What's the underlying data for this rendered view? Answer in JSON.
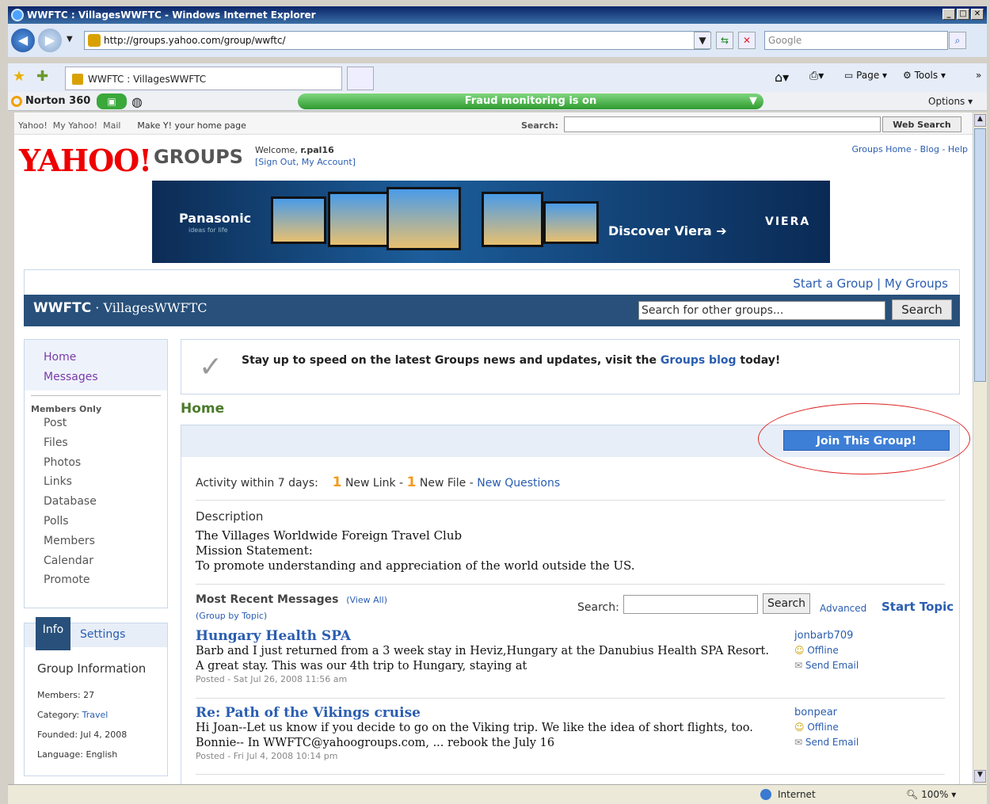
{
  "window": {
    "title": "WWFTC : VillagesWWFTC - Windows Internet Explorer"
  },
  "browser": {
    "address": "http://groups.yahoo.com/group/wwftc/",
    "search_placeholder": "Google",
    "tab_title": "WWFTC : VillagesWWFTC",
    "tools": {
      "page": "Page",
      "tools": "Tools"
    },
    "norton_label": "Norton 360",
    "fraud_status": "Fraud monitoring is on",
    "options": "Options",
    "status_zone": "Internet",
    "zoom": "100%"
  },
  "yahoo_bar": {
    "links": [
      "Yahoo!",
      "My Yahoo!",
      "Mail"
    ],
    "home_page": "Make Y! your home page",
    "search_label": "Search:",
    "search_button": "Web Search"
  },
  "header": {
    "logo": "YAHOO!",
    "logo_suffix": "GROUPS",
    "welcome_prefix": "Welcome, ",
    "username": "r.pal16",
    "sign_out": "[Sign Out, My Account]",
    "top_links": "Groups Home - Blog - Help"
  },
  "banner": {
    "brand": "Panasonic",
    "tagline": "ideas for life",
    "cta": "Discover Viera",
    "product": "VIERA"
  },
  "group_bar": {
    "links": "Start a Group | My Groups",
    "name": "WWFTC",
    "subname": " · VillagesWWFTC",
    "search_placeholder": "Search for other groups...",
    "search_button": "Search"
  },
  "leftnav": {
    "primary": [
      "Home",
      "Messages"
    ],
    "members_only_label": "Members Only",
    "items": [
      "Post",
      "Files",
      "Photos",
      "Links",
      "Database",
      "Polls",
      "Members",
      "Calendar",
      "Promote"
    ]
  },
  "info": {
    "tab_info": "Info",
    "tab_settings": "Settings",
    "heading": "Group Information",
    "members": "Members: 27",
    "category_label": "Category: ",
    "category_value": "Travel",
    "founded": "Founded: Jul 4, 2008",
    "language": "Language: English"
  },
  "news": {
    "text_before": "Stay up to speed on the latest Groups news and updates, visit the ",
    "link": "Groups blog",
    "text_after": " today!"
  },
  "main": {
    "title": "Home",
    "join_button": "Join This Group!",
    "activity_label": "Activity within 7 days:",
    "new_link_count": "1",
    "new_link_label": " New Link - ",
    "new_file_count": "1",
    "new_file_label": " New File - ",
    "new_questions": "New Questions",
    "description_label": "Description",
    "description_lines": [
      "The Villages Worldwide Foreign Travel Club",
      "Mission Statement:",
      "To promote understanding and appreciation of the world outside the US."
    ],
    "recent_label": "Most Recent Messages",
    "view_all": "(View All)",
    "group_by_topic": "(Group by Topic)",
    "search_label": "Search:",
    "search_button": "Search",
    "advanced": "Advanced",
    "start_topic": "Start Topic"
  },
  "messages": [
    {
      "title": "Hungary Health SPA",
      "body1": "Barb and I just returned from a 3 week stay in Heviz,Hungary at the Danubius Health SPA Resort.",
      "body2": "A great stay. This was our 4th trip to Hungary, staying at",
      "posted": "Posted - Sat Jul 26, 2008 11:56 am",
      "author": "jonbarb709",
      "status": "Offline",
      "send_email": "Send Email"
    },
    {
      "title": "Re: Path of the Vikings cruise",
      "body1": "Hi Joan--Let us know if you decide to go on the Viking trip. We like the idea of short flights, too.",
      "body2": "Bonnie-- In WWFTC@yahoogroups.com, ... rebook the July 16",
      "posted": "Posted - Fri Jul 4, 2008 10:14 pm",
      "author": "bonpear",
      "status": "Offline",
      "send_email": "Send Email"
    }
  ]
}
